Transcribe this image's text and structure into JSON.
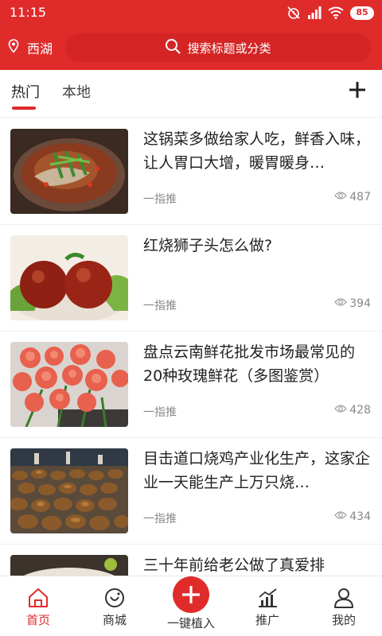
{
  "status": {
    "time": "11:15",
    "battery": "85"
  },
  "header": {
    "location": "西湖",
    "search_placeholder": "搜索标题或分类"
  },
  "tabs": [
    {
      "label": "热门",
      "active": true
    },
    {
      "label": "本地",
      "active": false
    }
  ],
  "feed": [
    {
      "title": "这锅菜多做给家人吃，鲜香入味，让人胃口大增，暖胃暖身…",
      "source": "一指推",
      "views": "487",
      "image": "fish-stew-photo"
    },
    {
      "title": "红烧狮子头怎么做?",
      "source": "一指推",
      "views": "394",
      "image": "braised-meatballs-photo"
    },
    {
      "title": "盘点云南鲜花批发市场最常见的20种玫瑰鲜花（多图鉴赏）",
      "source": "一指推",
      "views": "428",
      "image": "pink-roses-photo"
    },
    {
      "title": "目击道口烧鸡产业化生产，这家企业一天能生产上万只烧…",
      "source": "一指推",
      "views": "434",
      "image": "roast-chicken-factory-photo"
    },
    {
      "title": "三十年前给老公做了真爱排",
      "source": "",
      "views": "",
      "image": "food-plate-photo"
    }
  ],
  "bottom_nav": [
    {
      "label": "首页",
      "icon": "home-icon",
      "active": true
    },
    {
      "label": "商城",
      "icon": "shop-icon",
      "active": false
    },
    {
      "label": "一键植入",
      "icon": "plus-icon",
      "active": false
    },
    {
      "label": "推广",
      "icon": "chart-icon",
      "active": false
    },
    {
      "label": "我的",
      "icon": "user-icon",
      "active": false
    }
  ],
  "colors": {
    "brand": "#e02b2b",
    "text": "#222222",
    "muted": "#888888"
  }
}
